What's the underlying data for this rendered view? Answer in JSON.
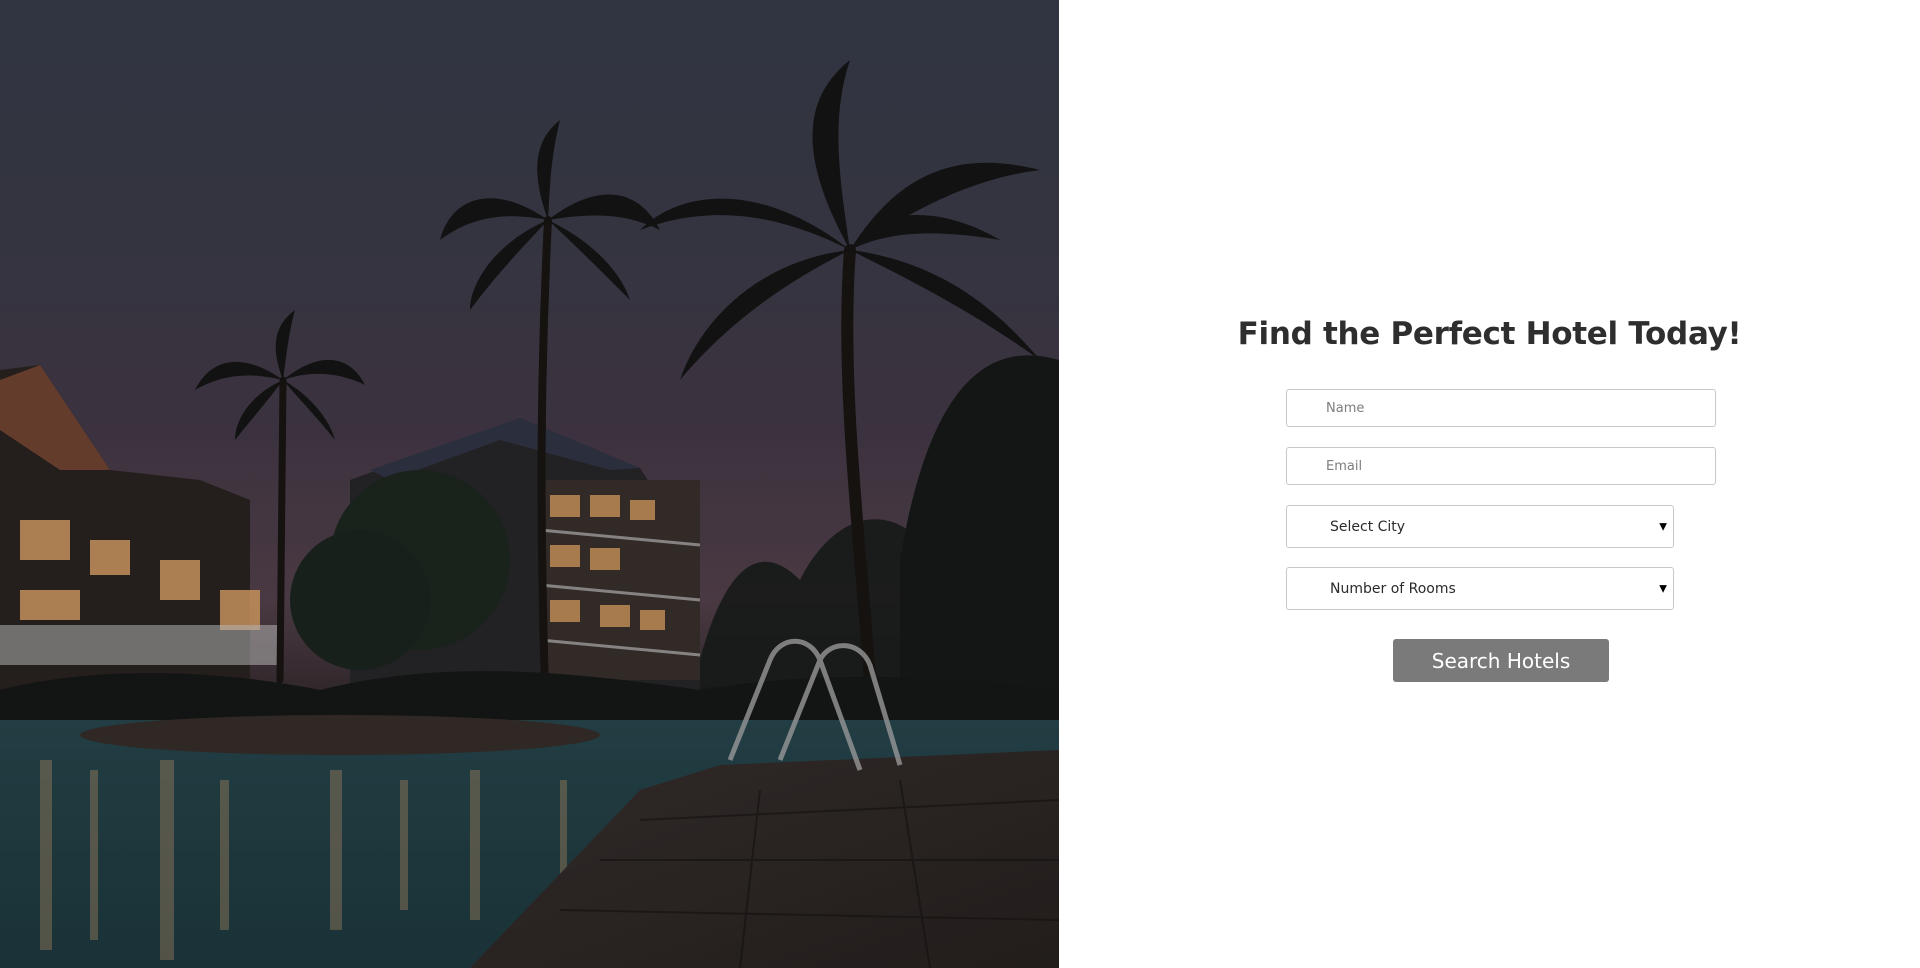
{
  "hero": {
    "image": "night-resort-pool-palm-trees"
  },
  "form": {
    "title": "Find the Perfect Hotel Today!",
    "name_placeholder": "Name",
    "email_placeholder": "Email",
    "city_select": {
      "selected": "Select City"
    },
    "rooms_select": {
      "selected": "Number of Rooms"
    },
    "submit_label": "Search Hotels"
  },
  "colors": {
    "button_bg": "#7a7a7a",
    "title_text": "#2e2e2e",
    "field_border": "#c8c8c8"
  }
}
